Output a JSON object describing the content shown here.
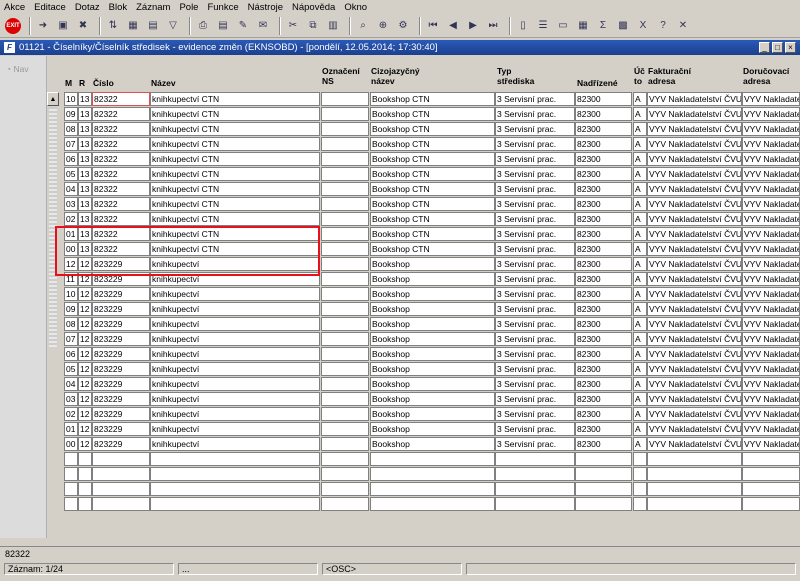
{
  "menu": [
    "Akce",
    "Editace",
    "Dotaz",
    "Blok",
    "Záznam",
    "Pole",
    "Funkce",
    "Nástroje",
    "Nápověda",
    "Okno"
  ],
  "toolbar": {
    "exit_label": "EXIT"
  },
  "window": {
    "title": "01121 - Číselníky/Číselník středisek - evidence změn (EKNSOBD) - [pondělí, 12.05.2014; 17:30:40]"
  },
  "left_panel": {
    "nav_label": "Nav"
  },
  "headers": {
    "m": "M",
    "r": "R",
    "cislo": "Číslo",
    "nazev": "Název",
    "oznaceni1": "Označení",
    "oznaceni2": "NS",
    "cizo1": "Cizojazyčný",
    "cizo2": "název",
    "typ1": "Typ",
    "typ2": "střediska",
    "nadrizene": "Nadřízené",
    "uc1": "Úč",
    "uc2": "to",
    "fakt1": "Fakturační",
    "fakt2": "adresa",
    "dor1": "Doručovací",
    "dor2": "adresa"
  },
  "rows": [
    {
      "m": "10",
      "r": "13",
      "cislo": "82322",
      "nazev": "knihkupectví CTN",
      "ozn": "",
      "cizo": "Bookshop CTN",
      "typ": "3 Servisní prac.",
      "nadr": "82300",
      "uc": "A",
      "fakt": "VYV Nakladatelství ČVUT",
      "dor": "VYV Nakladatelství"
    },
    {
      "m": "09",
      "r": "13",
      "cislo": "82322",
      "nazev": "knihkupectví CTN",
      "ozn": "",
      "cizo": "Bookshop CTN",
      "typ": "3 Servisní prac.",
      "nadr": "82300",
      "uc": "A",
      "fakt": "VYV Nakladatelství ČVUT",
      "dor": "VYV Nakladatelství"
    },
    {
      "m": "08",
      "r": "13",
      "cislo": "82322",
      "nazev": "knihkupectví CTN",
      "ozn": "",
      "cizo": "Bookshop CTN",
      "typ": "3 Servisní prac.",
      "nadr": "82300",
      "uc": "A",
      "fakt": "VYV Nakladatelství ČVUT",
      "dor": "VYV Nakladatelství"
    },
    {
      "m": "07",
      "r": "13",
      "cislo": "82322",
      "nazev": "knihkupectví CTN",
      "ozn": "",
      "cizo": "Bookshop CTN",
      "typ": "3 Servisní prac.",
      "nadr": "82300",
      "uc": "A",
      "fakt": "VYV Nakladatelství ČVUT",
      "dor": "VYV Nakladatelství"
    },
    {
      "m": "06",
      "r": "13",
      "cislo": "82322",
      "nazev": "knihkupectví CTN",
      "ozn": "",
      "cizo": "Bookshop CTN",
      "typ": "3 Servisní prac.",
      "nadr": "82300",
      "uc": "A",
      "fakt": "VYV Nakladatelství ČVUT",
      "dor": "VYV Nakladatelství"
    },
    {
      "m": "05",
      "r": "13",
      "cislo": "82322",
      "nazev": "knihkupectví CTN",
      "ozn": "",
      "cizo": "Bookshop CTN",
      "typ": "3 Servisní prac.",
      "nadr": "82300",
      "uc": "A",
      "fakt": "VYV Nakladatelství ČVUT",
      "dor": "VYV Nakladatelství"
    },
    {
      "m": "04",
      "r": "13",
      "cislo": "82322",
      "nazev": "knihkupectví CTN",
      "ozn": "",
      "cizo": "Bookshop CTN",
      "typ": "3 Servisní prac.",
      "nadr": "82300",
      "uc": "A",
      "fakt": "VYV Nakladatelství ČVUT",
      "dor": "VYV Nakladatelství"
    },
    {
      "m": "03",
      "r": "13",
      "cislo": "82322",
      "nazev": "knihkupectví CTN",
      "ozn": "",
      "cizo": "Bookshop CTN",
      "typ": "3 Servisní prac.",
      "nadr": "82300",
      "uc": "A",
      "fakt": "VYV Nakladatelství ČVUT",
      "dor": "VYV Nakladatelství"
    },
    {
      "m": "02",
      "r": "13",
      "cislo": "82322",
      "nazev": "knihkupectví CTN",
      "ozn": "",
      "cizo": "Bookshop CTN",
      "typ": "3 Servisní prac.",
      "nadr": "82300",
      "uc": "A",
      "fakt": "VYV Nakladatelství ČVUT",
      "dor": "VYV Nakladatelství"
    },
    {
      "m": "01",
      "r": "13",
      "cislo": "82322",
      "nazev": "knihkupectví CTN",
      "ozn": "",
      "cizo": "Bookshop CTN",
      "typ": "3 Servisní prac.",
      "nadr": "82300",
      "uc": "A",
      "fakt": "VYV Nakladatelství ČVUT",
      "dor": "VYV Nakladatelství"
    },
    {
      "m": "00",
      "r": "13",
      "cislo": "82322",
      "nazev": "knihkupectví CTN",
      "ozn": "",
      "cizo": "Bookshop CTN",
      "typ": "3 Servisní prac.",
      "nadr": "82300",
      "uc": "A",
      "fakt": "VYV Nakladatelství ČVUT",
      "dor": "VYV Nakladatelství"
    },
    {
      "m": "12",
      "r": "12",
      "cislo": "823229",
      "nazev": "knihkupectví",
      "ozn": "",
      "cizo": "Bookshop",
      "typ": "3 Servisní prac.",
      "nadr": "82300",
      "uc": "A",
      "fakt": "VYV Nakladatelství ČVUT",
      "dor": "VYV Nakladatelství"
    },
    {
      "m": "11",
      "r": "12",
      "cislo": "823229",
      "nazev": "knihkupectví",
      "ozn": "",
      "cizo": "Bookshop",
      "typ": "3 Servisní prac.",
      "nadr": "82300",
      "uc": "A",
      "fakt": "VYV Nakladatelství ČVUT",
      "dor": "VYV Nakladatelství"
    },
    {
      "m": "10",
      "r": "12",
      "cislo": "823229",
      "nazev": "knihkupectví",
      "ozn": "",
      "cizo": "Bookshop",
      "typ": "3 Servisní prac.",
      "nadr": "82300",
      "uc": "A",
      "fakt": "VYV Nakladatelství ČVUT",
      "dor": "VYV Nakladatelství"
    },
    {
      "m": "09",
      "r": "12",
      "cislo": "823229",
      "nazev": "knihkupectví",
      "ozn": "",
      "cizo": "Bookshop",
      "typ": "3 Servisní prac.",
      "nadr": "82300",
      "uc": "A",
      "fakt": "VYV Nakladatelství ČVUT",
      "dor": "VYV Nakladatelství"
    },
    {
      "m": "08",
      "r": "12",
      "cislo": "823229",
      "nazev": "knihkupectví",
      "ozn": "",
      "cizo": "Bookshop",
      "typ": "3 Servisní prac.",
      "nadr": "82300",
      "uc": "A",
      "fakt": "VYV Nakladatelství ČVUT",
      "dor": "VYV Nakladatelství"
    },
    {
      "m": "07",
      "r": "12",
      "cislo": "823229",
      "nazev": "knihkupectví",
      "ozn": "",
      "cizo": "Bookshop",
      "typ": "3 Servisní prac.",
      "nadr": "82300",
      "uc": "A",
      "fakt": "VYV Nakladatelství ČVUT",
      "dor": "VYV Nakladatelství"
    },
    {
      "m": "06",
      "r": "12",
      "cislo": "823229",
      "nazev": "knihkupectví",
      "ozn": "",
      "cizo": "Bookshop",
      "typ": "3 Servisní prac.",
      "nadr": "82300",
      "uc": "A",
      "fakt": "VYV Nakladatelství ČVUT",
      "dor": "VYV Nakladatelství"
    },
    {
      "m": "05",
      "r": "12",
      "cislo": "823229",
      "nazev": "knihkupectví",
      "ozn": "",
      "cizo": "Bookshop",
      "typ": "3 Servisní prac.",
      "nadr": "82300",
      "uc": "A",
      "fakt": "VYV Nakladatelství ČVUT",
      "dor": "VYV Nakladatelství"
    },
    {
      "m": "04",
      "r": "12",
      "cislo": "823229",
      "nazev": "knihkupectví",
      "ozn": "",
      "cizo": "Bookshop",
      "typ": "3 Servisní prac.",
      "nadr": "82300",
      "uc": "A",
      "fakt": "VYV Nakladatelství ČVUT",
      "dor": "VYV Nakladatelství"
    },
    {
      "m": "03",
      "r": "12",
      "cislo": "823229",
      "nazev": "knihkupectví",
      "ozn": "",
      "cizo": "Bookshop",
      "typ": "3 Servisní prac.",
      "nadr": "82300",
      "uc": "A",
      "fakt": "VYV Nakladatelství ČVUT",
      "dor": "VYV Nakladatelství"
    },
    {
      "m": "02",
      "r": "12",
      "cislo": "823229",
      "nazev": "knihkupectví",
      "ozn": "",
      "cizo": "Bookshop",
      "typ": "3 Servisní prac.",
      "nadr": "82300",
      "uc": "A",
      "fakt": "VYV Nakladatelství ČVUT",
      "dor": "VYV Nakladatelství"
    },
    {
      "m": "01",
      "r": "12",
      "cislo": "823229",
      "nazev": "knihkupectví",
      "ozn": "",
      "cizo": "Bookshop",
      "typ": "3 Servisní prac.",
      "nadr": "82300",
      "uc": "A",
      "fakt": "VYV Nakladatelství ČVUT",
      "dor": "VYV Nakladatelství"
    },
    {
      "m": "00",
      "r": "12",
      "cislo": "823229",
      "nazev": "knihkupectví",
      "ozn": "",
      "cizo": "Bookshop",
      "typ": "3 Servisní prac.",
      "nadr": "82300",
      "uc": "A",
      "fakt": "VYV Nakladatelství ČVUT",
      "dor": "VYV Nakladatelství"
    }
  ],
  "empty_rows": 4,
  "status": {
    "field_value": "82322",
    "record": "Záznam: 1/24",
    "seg2": "...",
    "mode": "<OSC>"
  }
}
